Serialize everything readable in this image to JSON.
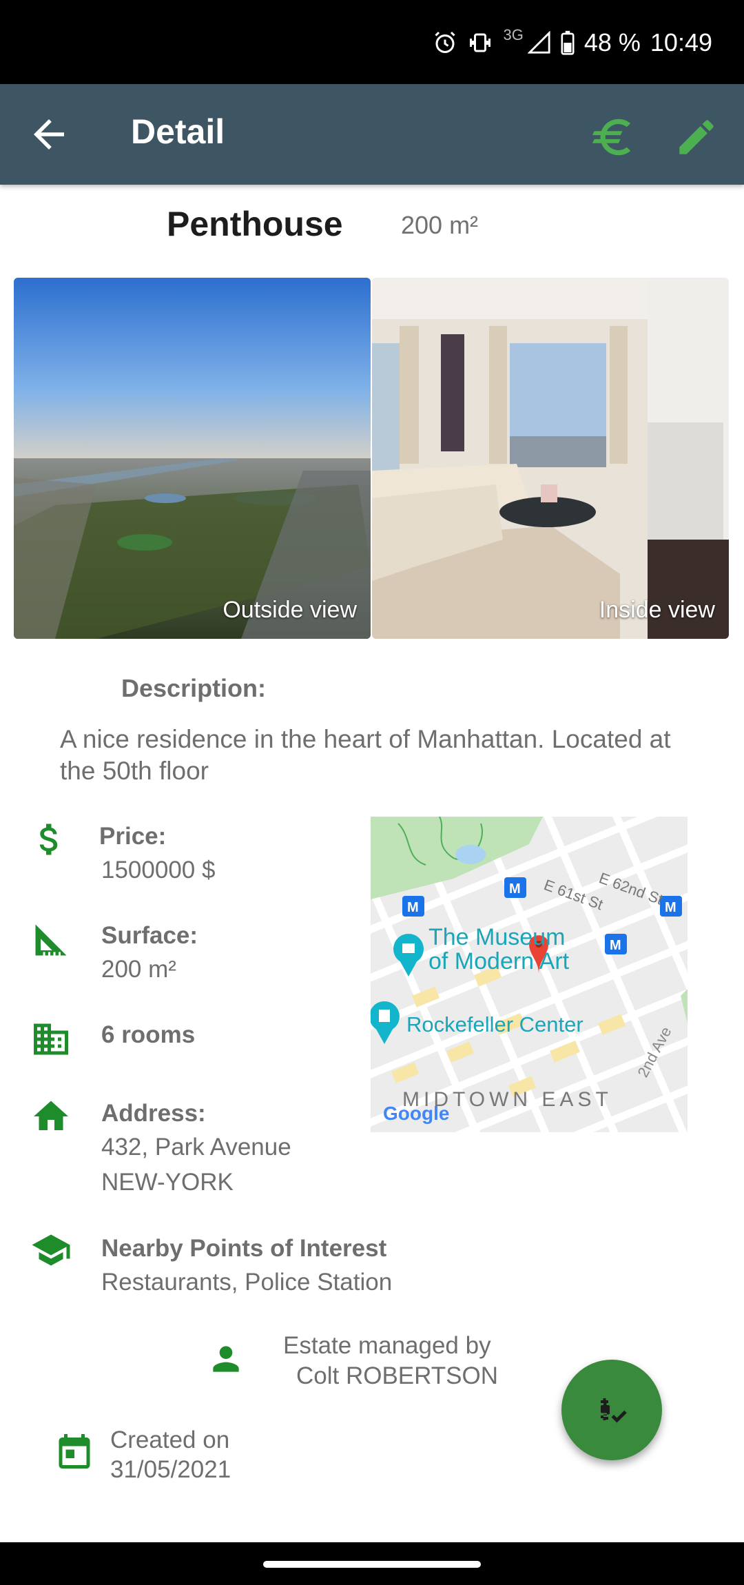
{
  "status_bar": {
    "network": "3G",
    "battery": "48 %",
    "time": "10:49"
  },
  "toolbar": {
    "title": "Detail",
    "back_icon": "arrow-back-icon",
    "currency_icon": "euro-icon",
    "edit_icon": "pencil-icon",
    "accent": "#4caf50"
  },
  "property": {
    "type": "Penthouse",
    "surface": "200 m²"
  },
  "photos": [
    {
      "caption": "Outside view"
    },
    {
      "caption": "Inside view"
    }
  ],
  "description": {
    "label": "Description:",
    "text": "A nice residence in the heart of Manhattan. Located at the 50th floor"
  },
  "details": {
    "price_label": "Price:",
    "price_value": "1500000 $",
    "surface_label": "Surface:",
    "surface_value": "200 m²",
    "rooms": "6 rooms",
    "address_label": "Address:",
    "address_line1": "432, Park Avenue",
    "address_line2": "NEW-YORK",
    "poi_label": "Nearby Points of Interest",
    "poi_value": "Restaurants, Police Station",
    "icon_color": "#1e8c2a"
  },
  "map": {
    "label_museum_1": "The Museum",
    "label_museum_2": "of Modern Art",
    "label_rockefeller": "Rockefeller Center",
    "label_district": "MIDTOWN EAST",
    "label_street_1": "E 61st St",
    "label_street_2": "E 62nd St",
    "label_avenue": "2nd Ave",
    "label_google": "Google"
  },
  "agent": {
    "line1": "Estate managed by",
    "line2": "Colt ROBERTSON"
  },
  "created": {
    "line1": "Created on",
    "line2": "31/05/2021"
  },
  "fab": {
    "icon": "price-check-icon",
    "color": "#3a8a3e"
  }
}
